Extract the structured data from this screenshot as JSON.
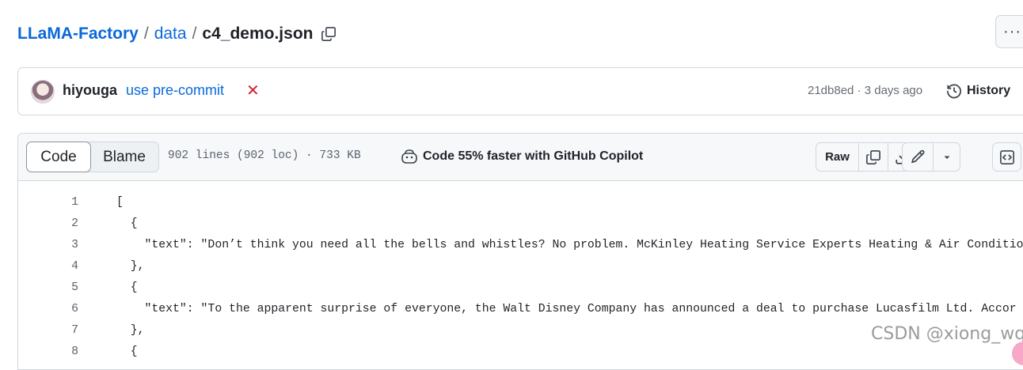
{
  "breadcrumb": {
    "repo": "LLaMA-Factory",
    "separator": "/",
    "folder": "data",
    "file": "c4_demo.json"
  },
  "more_label": "···",
  "commit": {
    "author": "hiyouga",
    "message": "use pre-commit",
    "status": "failed",
    "status_symbol": "✕",
    "meta": "21db8ed · 3 days ago",
    "history_label": "History"
  },
  "file_header": {
    "tabs": [
      {
        "label": "Code",
        "selected": true
      },
      {
        "label": "Blame",
        "selected": false
      }
    ],
    "info": "902 lines (902 loc) · 733 KB",
    "copilot_label": "Code 55% faster with GitHub Copilot",
    "raw_label": "Raw"
  },
  "code": {
    "lines": [
      {
        "num": "1",
        "text": "["
      },
      {
        "num": "2",
        "text": "  {"
      },
      {
        "num": "3",
        "text": "    \"text\": \"Don’t think you need all the bells and whistles? No problem. McKinley Heating Service Experts Heating & Air Conditio"
      },
      {
        "num": "4",
        "text": "  },"
      },
      {
        "num": "5",
        "text": "  {"
      },
      {
        "num": "6",
        "text": "    \"text\": \"To the apparent surprise of everyone, the Walt Disney Company has announced a deal to purchase Lucasfilm Ltd. Accor"
      },
      {
        "num": "7",
        "text": "  },"
      },
      {
        "num": "8",
        "text": "  {"
      }
    ]
  },
  "watermark": "CSDN @xiong_wq",
  "colors": {
    "link": "#0969da",
    "danger": "#cf222e",
    "muted": "#656d76",
    "border": "#d0d7de",
    "header_bg": "#f6f8fa"
  },
  "icons": [
    "copy-icon",
    "kebab-horizontal-icon",
    "x-icon",
    "history-icon",
    "copilot-icon",
    "copy-icon",
    "download-icon",
    "pencil-icon",
    "triangle-down-icon",
    "code-square-icon"
  ]
}
